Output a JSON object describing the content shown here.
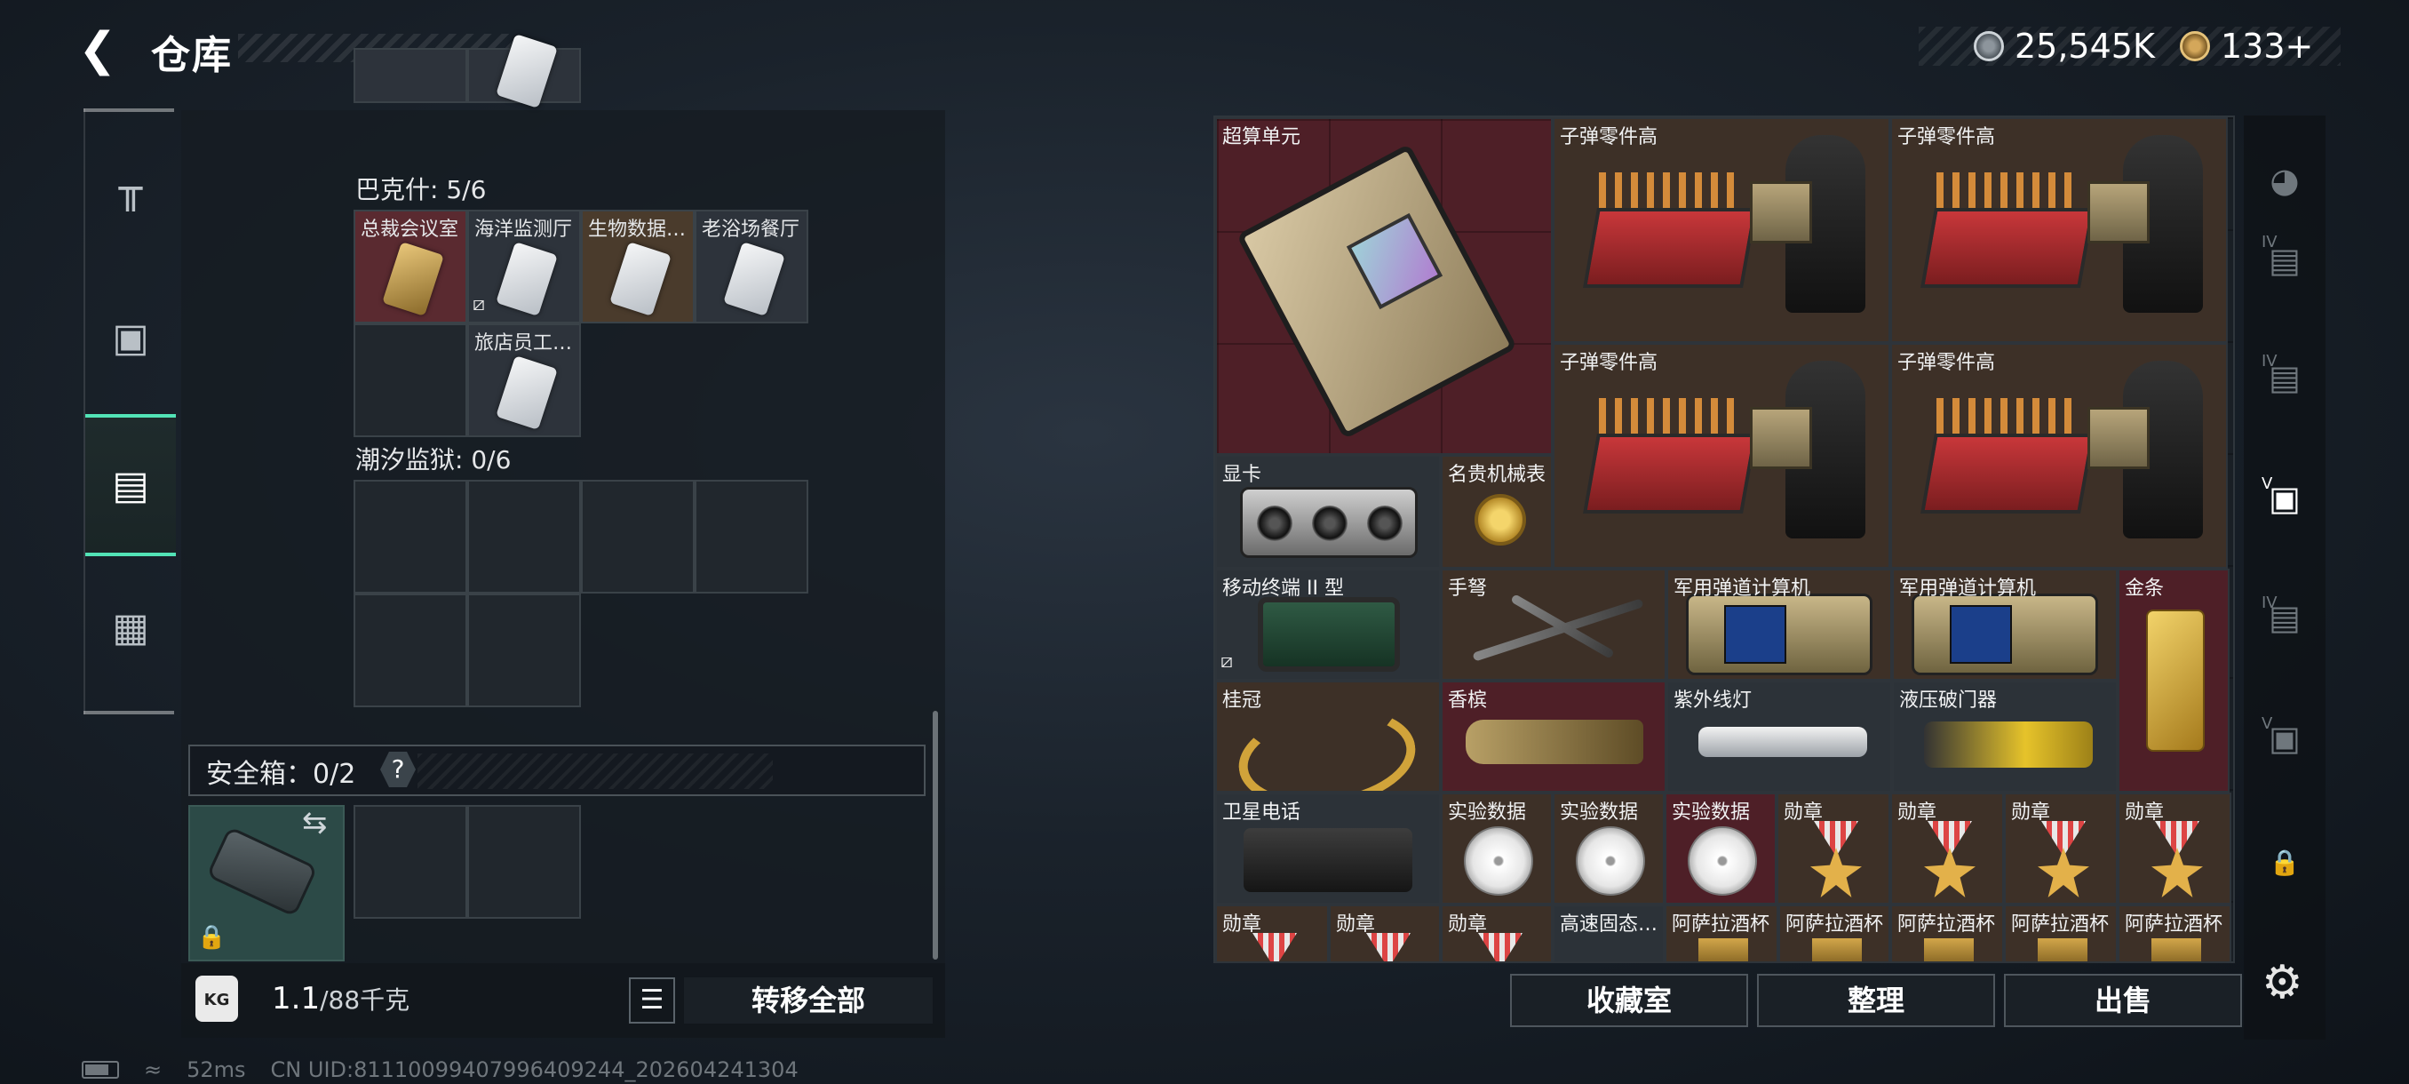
{
  "header": {
    "back_icon": "back-arrow-icon",
    "title": "仓库",
    "currency_silver": "25,545K",
    "currency_gold": "133+",
    "silver_icon": "silver-coin-icon",
    "gold_icon": "gold-coin-icon"
  },
  "left_nav": [
    {
      "icon": "gun-icon",
      "glyph": "╤"
    },
    {
      "icon": "armor-icon",
      "glyph": "▣"
    },
    {
      "icon": "backpack-icon",
      "glyph": "▤",
      "active": true
    },
    {
      "icon": "toolbox-icon",
      "glyph": "▦"
    }
  ],
  "keycards": {
    "bakeshi_title": "巴克什: 5/6",
    "bakeshi": [
      {
        "label": "总裁会议室",
        "style": "gold"
      },
      {
        "label": "海洋监测厅",
        "style": "silver"
      },
      {
        "label": "生物数据…",
        "style": "silver"
      },
      {
        "label": "老浴场餐厅",
        "style": "silver"
      },
      {
        "label": "旅店员工…",
        "style": "silver"
      }
    ],
    "chaoxi_title": "潮汐监狱: 0/6"
  },
  "safe": {
    "label": "安全箱：0/2",
    "help": "?",
    "swap_icon": "swap-icon",
    "lock_icon": "lock-icon"
  },
  "bottom_left": {
    "weight_value": "1.1",
    "weight_total": "/88千克",
    "list_icon": "list-icon",
    "transfer_label": "转移全部"
  },
  "items": {
    "supercomputer": "超算单元",
    "ammo_parts": "子弹零件高",
    "gpu": "显卡",
    "watch": "名贵机械表",
    "mobile_terminal": "移动终端 II 型",
    "crossbow": "手弩",
    "ballistic_computer": "军用弹道计算机",
    "gold_bar": "金条",
    "laurel": "桂冠",
    "champagne": "香槟",
    "uv_lamp": "紫外线灯",
    "hydraulic_breaker": "液压破门器",
    "sat_phone": "卫星电话",
    "lab_data": "实验数据",
    "medal": "勋章",
    "ssd": "高速固态…",
    "asara_cup": "阿萨拉酒杯"
  },
  "buttons": {
    "collection": "收藏室",
    "organize": "整理",
    "sell": "出售"
  },
  "right_nav": [
    {
      "icon": "helmet-icon"
    },
    {
      "icon": "vest-iv-icon",
      "sub": "IV"
    },
    {
      "icon": "vest-iv-icon",
      "sub": "IV"
    },
    {
      "icon": "vest-v-icon",
      "sub": "V",
      "active": true
    },
    {
      "icon": "bag-iv-icon",
      "sub": "IV"
    },
    {
      "icon": "vest-v-icon",
      "sub": "V"
    },
    {
      "icon": "lock-icon"
    }
  ],
  "settings_icon": "gear-icon",
  "status": {
    "ping": "52ms",
    "uid": "CN UID:81110099407996409244_202604241304"
  }
}
